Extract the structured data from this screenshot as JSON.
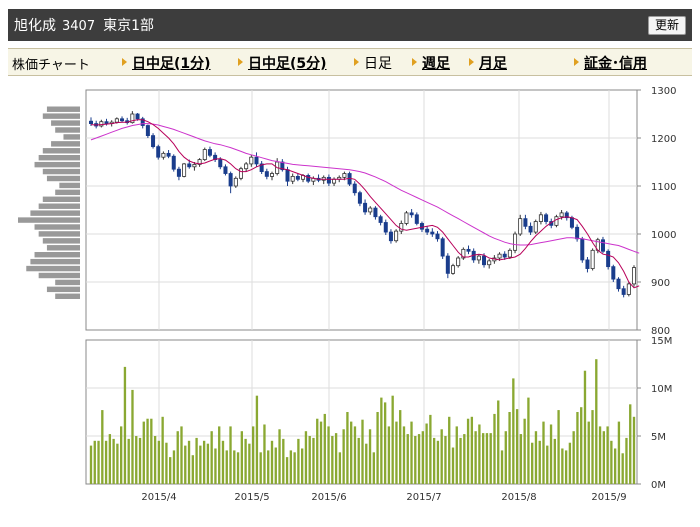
{
  "header": {
    "name": "旭化成",
    "code": "3407",
    "market": "東京1部",
    "refresh_label": "更新"
  },
  "nav": {
    "label": "株価チャート",
    "items": [
      {
        "label": "日中足(1分)",
        "current": false
      },
      {
        "label": "日中足(5分)",
        "current": false
      },
      {
        "label": "日足",
        "current": true
      },
      {
        "label": "週足",
        "current": false
      },
      {
        "label": "月足",
        "current": false
      },
      {
        "label": "証金･信用",
        "current": false
      }
    ]
  },
  "chart_data": [
    {
      "type": "candlestick",
      "title": "",
      "ylim": [
        800,
        1300
      ],
      "yticks": [
        "1300",
        "1200",
        "1100",
        "1000",
        "900",
        "800"
      ],
      "xticks": [
        "2015/4",
        "2015/5",
        "2015/6",
        "2015/7",
        "2015/8",
        "2015/9"
      ],
      "colors": {
        "up": "#ffffff",
        "down": "#1a3d8c",
        "ma_short": "#b8005a",
        "ma_long": "#cc33cc",
        "volume": "#8aa832",
        "volume_profile": "#999999"
      },
      "candles": [
        [
          1235,
          1243,
          1225,
          1230
        ],
        [
          1230,
          1236,
          1220,
          1225
        ],
        [
          1225,
          1238,
          1222,
          1234
        ],
        [
          1234,
          1240,
          1226,
          1230
        ],
        [
          1230,
          1237,
          1224,
          1233
        ],
        [
          1233,
          1243,
          1230,
          1240
        ],
        [
          1240,
          1245,
          1232,
          1236
        ],
        [
          1236,
          1242,
          1228,
          1232
        ],
        [
          1232,
          1256,
          1230,
          1250
        ],
        [
          1250,
          1252,
          1236,
          1240
        ],
        [
          1240,
          1244,
          1220,
          1226
        ],
        [
          1226,
          1228,
          1200,
          1205
        ],
        [
          1205,
          1210,
          1178,
          1182
        ],
        [
          1182,
          1186,
          1155,
          1160
        ],
        [
          1160,
          1172,
          1155,
          1168
        ],
        [
          1168,
          1175,
          1158,
          1162
        ],
        [
          1162,
          1166,
          1130,
          1135
        ],
        [
          1135,
          1140,
          1112,
          1120
        ],
        [
          1120,
          1148,
          1118,
          1146
        ],
        [
          1146,
          1155,
          1136,
          1140
        ],
        [
          1140,
          1150,
          1132,
          1145
        ],
        [
          1145,
          1158,
          1140,
          1155
        ],
        [
          1155,
          1180,
          1152,
          1176
        ],
        [
          1176,
          1182,
          1160,
          1164
        ],
        [
          1164,
          1170,
          1150,
          1155
        ],
        [
          1155,
          1160,
          1135,
          1140
        ],
        [
          1140,
          1145,
          1122,
          1126
        ],
        [
          1126,
          1130,
          1085,
          1100
        ],
        [
          1100,
          1120,
          1096,
          1116
        ],
        [
          1116,
          1140,
          1112,
          1136
        ],
        [
          1136,
          1150,
          1130,
          1146
        ],
        [
          1146,
          1165,
          1140,
          1160
        ],
        [
          1160,
          1170,
          1140,
          1146
        ],
        [
          1146,
          1152,
          1125,
          1130
        ],
        [
          1130,
          1136,
          1114,
          1120
        ],
        [
          1120,
          1130,
          1112,
          1126
        ],
        [
          1126,
          1158,
          1122,
          1150
        ],
        [
          1150,
          1156,
          1130,
          1134
        ],
        [
          1134,
          1140,
          1100,
          1110
        ],
        [
          1110,
          1126,
          1104,
          1120
        ],
        [
          1120,
          1126,
          1110,
          1114
        ],
        [
          1114,
          1125,
          1108,
          1122
        ],
        [
          1122,
          1126,
          1106,
          1110
        ],
        [
          1110,
          1120,
          1102,
          1116
        ],
        [
          1116,
          1124,
          1108,
          1112
        ],
        [
          1112,
          1122,
          1104,
          1118
        ],
        [
          1118,
          1124,
          1100,
          1106
        ],
        [
          1106,
          1118,
          1100,
          1114
        ],
        [
          1114,
          1122,
          1108,
          1118
        ],
        [
          1118,
          1130,
          1112,
          1126
        ],
        [
          1126,
          1130,
          1100,
          1104
        ],
        [
          1104,
          1110,
          1080,
          1086
        ],
        [
          1086,
          1090,
          1058,
          1064
        ],
        [
          1064,
          1072,
          1040,
          1046
        ],
        [
          1046,
          1058,
          1040,
          1054
        ],
        [
          1054,
          1058,
          1030,
          1036
        ],
        [
          1036,
          1040,
          1018,
          1024
        ],
        [
          1024,
          1030,
          998,
          1004
        ],
        [
          1004,
          1010,
          980,
          986
        ],
        [
          986,
          1010,
          982,
          1006
        ],
        [
          1006,
          1028,
          1000,
          1022
        ],
        [
          1022,
          1048,
          1018,
          1044
        ],
        [
          1044,
          1052,
          1034,
          1040
        ],
        [
          1040,
          1045,
          1018,
          1022
        ],
        [
          1022,
          1026,
          1004,
          1010
        ],
        [
          1010,
          1016,
          998,
          1004
        ],
        [
          1004,
          1012,
          994,
          1000
        ],
        [
          1000,
          1006,
          984,
          990
        ],
        [
          990,
          994,
          948,
          954
        ],
        [
          954,
          960,
          908,
          918
        ],
        [
          918,
          938,
          915,
          934
        ],
        [
          934,
          954,
          930,
          950
        ],
        [
          950,
          972,
          946,
          968
        ],
        [
          968,
          976,
          958,
          964
        ],
        [
          964,
          970,
          940,
          946
        ],
        [
          946,
          958,
          938,
          954
        ],
        [
          954,
          960,
          930,
          936
        ],
        [
          936,
          948,
          928,
          944
        ],
        [
          944,
          956,
          938,
          950
        ],
        [
          950,
          962,
          944,
          958
        ],
        [
          958,
          964,
          946,
          952
        ],
        [
          952,
          970,
          948,
          966
        ],
        [
          966,
          1005,
          960,
          1000
        ],
        [
          1000,
          1040,
          996,
          1032
        ],
        [
          1032,
          1040,
          1010,
          1016
        ],
        [
          1016,
          1024,
          998,
          1004
        ],
        [
          1004,
          1030,
          1000,
          1026
        ],
        [
          1026,
          1046,
          1020,
          1040
        ],
        [
          1040,
          1044,
          1020,
          1026
        ],
        [
          1026,
          1032,
          1012,
          1018
        ],
        [
          1018,
          1040,
          1014,
          1036
        ],
        [
          1036,
          1050,
          1030,
          1044
        ],
        [
          1044,
          1048,
          1028,
          1034
        ],
        [
          1034,
          1038,
          1010,
          1014
        ],
        [
          1014,
          1020,
          984,
          990
        ],
        [
          990,
          994,
          940,
          946
        ],
        [
          946,
          952,
          920,
          928
        ],
        [
          928,
          970,
          924,
          966
        ],
        [
          966,
          992,
          960,
          988
        ],
        [
          988,
          994,
          960,
          964
        ],
        [
          964,
          968,
          926,
          932
        ],
        [
          932,
          936,
          900,
          906
        ],
        [
          906,
          910,
          880,
          886
        ],
        [
          886,
          892,
          868,
          874
        ],
        [
          874,
          900,
          870,
          896
        ],
        [
          896,
          935,
          890,
          930
        ]
      ],
      "ma_short": [
        1228,
        1227,
        1228,
        1229,
        1230,
        1232,
        1233,
        1233,
        1236,
        1238,
        1238,
        1234,
        1228,
        1220,
        1210,
        1200,
        1188,
        1172,
        1160,
        1152,
        1148,
        1146,
        1148,
        1152,
        1156,
        1157,
        1154,
        1146,
        1136,
        1130,
        1130,
        1134,
        1140,
        1144,
        1146,
        1146,
        1138,
        1136,
        1134,
        1130,
        1126,
        1122,
        1118,
        1116,
        1114,
        1114,
        1114,
        1114,
        1114,
        1114,
        1116,
        1114,
        1104,
        1092,
        1078,
        1066,
        1054,
        1042,
        1030,
        1018,
        1010,
        1008,
        1010,
        1012,
        1014,
        1016,
        1018,
        1014,
        1004,
        990,
        976,
        962,
        952,
        952,
        956,
        958,
        956,
        950,
        948,
        946,
        948,
        950,
        952,
        958,
        970,
        984,
        996,
        1006,
        1016,
        1024,
        1030,
        1034,
        1036,
        1034,
        1030,
        1016,
        1000,
        982,
        966,
        958,
        956,
        952,
        940,
        922,
        900,
        888,
        892
      ],
      "ma_long": [
        1196,
        1200,
        1204,
        1208,
        1212,
        1216,
        1220,
        1223,
        1226,
        1228,
        1230,
        1230,
        1229,
        1227,
        1224,
        1221,
        1218,
        1214,
        1210,
        1206,
        1202,
        1198,
        1194,
        1191,
        1188,
        1186,
        1183,
        1180,
        1176,
        1172,
        1168,
        1165,
        1162,
        1159,
        1156,
        1153,
        1151,
        1149,
        1147,
        1145,
        1144,
        1143,
        1142,
        1141,
        1140,
        1139,
        1138,
        1137,
        1136,
        1135,
        1134,
        1132,
        1130,
        1127,
        1123,
        1119,
        1114,
        1109,
        1103,
        1097,
        1091,
        1086,
        1081,
        1076,
        1071,
        1066,
        1061,
        1056,
        1050,
        1044,
        1038,
        1032,
        1026,
        1020,
        1014,
        1008,
        1002,
        996,
        991,
        987,
        983,
        980,
        978,
        977,
        977,
        978,
        980,
        982,
        984,
        986,
        988,
        990,
        992,
        992,
        991,
        990,
        988,
        986,
        984,
        982,
        980,
        978,
        976,
        972,
        968,
        964,
        960
      ],
      "volume_profile": [
        4.0,
        4.5,
        3.5,
        3.0,
        2.0,
        3.5,
        4.5,
        5.0,
        5.5,
        4.5,
        4.0,
        2.5,
        3.0,
        4.5,
        5.0,
        6.0,
        7.5,
        5.5,
        5.0,
        4.5,
        4.0,
        5.5,
        6.0,
        6.5,
        5.0,
        3.0,
        4.0,
        3.0
      ]
    },
    {
      "type": "bar",
      "title": "",
      "ylim": [
        0,
        15
      ],
      "yticks": [
        "15M",
        "10M",
        "5M",
        "0M"
      ],
      "values": [
        4.0,
        4.5,
        4.5,
        7.7,
        4.5,
        5.2,
        4.7,
        4.2,
        6.0,
        12.2,
        4.7,
        9.8,
        5.0,
        4.8,
        6.5,
        6.8,
        6.8,
        5.0,
        4.5,
        7.0,
        4.3,
        2.8,
        3.5,
        5.5,
        6.0,
        4.0,
        4.5,
        3.0,
        4.8,
        4.0,
        4.5,
        4.2,
        5.5,
        3.7,
        6.0,
        4.5,
        3.5,
        6.0,
        3.5,
        3.3,
        5.5,
        4.7,
        4.2,
        6.0,
        9.2,
        3.3,
        6.2,
        3.5,
        4.5,
        3.8,
        5.7,
        4.7,
        2.8,
        3.5,
        3.3,
        4.7,
        3.7,
        5.5,
        5.0,
        4.8,
        6.8,
        6.5,
        7.3,
        6.0,
        5.0,
        5.3,
        3.3,
        5.7,
        7.5,
        6.5,
        6.0,
        4.8,
        6.7,
        4.2,
        5.7,
        3.3,
        7.5,
        9.0,
        8.5,
        6.0,
        9.2,
        6.5,
        7.7,
        6.0,
        5.2,
        6.5,
        5.0,
        5.2,
        5.5,
        6.3,
        7.2,
        4.8,
        4.5,
        5.7,
        5.0,
        7.0,
        3.8,
        6.0,
        4.8,
        5.2,
        6.8,
        7.0,
        5.5,
        6.2,
        5.3,
        5.3,
        5.3,
        7.3,
        8.7,
        3.5,
        5.5,
        7.5,
        11.0,
        7.8,
        5.2,
        6.8,
        9.0,
        4.3,
        5.5,
        4.5,
        6.5,
        4.0,
        6.2,
        4.7,
        7.7,
        3.7,
        3.5,
        4.3,
        5.5,
        7.5,
        8.0,
        11.8,
        6.5,
        7.7,
        13.0,
        6.0,
        5.5,
        6.0,
        4.5,
        3.7,
        6.5,
        3.2,
        4.8,
        8.3,
        7.0
      ]
    }
  ]
}
